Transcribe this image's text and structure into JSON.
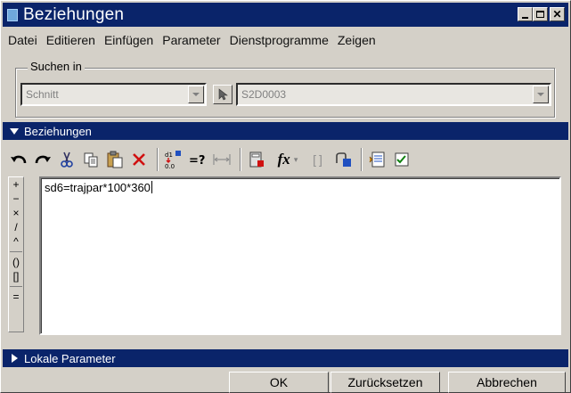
{
  "window": {
    "title": "Beziehungen"
  },
  "menu": [
    "Datei",
    "Editieren",
    "Einfügen",
    "Parameter",
    "Dienstprogramme",
    "Zeigen"
  ],
  "search_in": {
    "label": "Suchen in",
    "filter_value": "Schnitt",
    "object_value": "S2D0003"
  },
  "relations_section": {
    "title": "Beziehungen"
  },
  "operators": [
    "+",
    "−",
    "×",
    "/",
    "^",
    "()",
    "[]",
    "="
  ],
  "editor": {
    "text": "sd6=trajpar*100*360"
  },
  "local_params_section": {
    "title": "Lokale Parameter"
  },
  "buttons": {
    "ok": "OK",
    "reset": "Zurücksetzen",
    "cancel": "Abbrechen"
  },
  "colors": {
    "titlebar": "#0a246a",
    "face": "#d4d0c8"
  }
}
